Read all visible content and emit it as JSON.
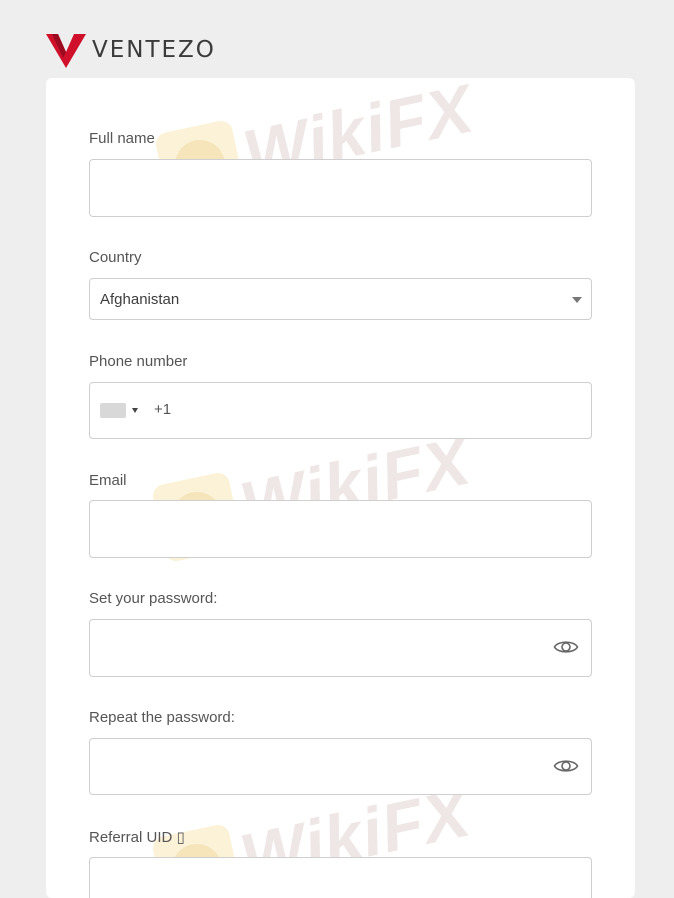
{
  "brand": {
    "name": "VENTEZO"
  },
  "form": {
    "full_name": {
      "label": "Full name",
      "value": ""
    },
    "country": {
      "label": "Country",
      "value": "Afghanistan"
    },
    "phone": {
      "label": "Phone number",
      "dial_code": "+1",
      "value": ""
    },
    "email": {
      "label": "Email",
      "value": ""
    },
    "password": {
      "label": "Set your password:",
      "value": ""
    },
    "repeat_password": {
      "label": "Repeat the password:",
      "value": ""
    },
    "referral": {
      "label": "Referral UID ▯",
      "value": ""
    }
  },
  "watermark": {
    "text": "WikiFX"
  },
  "colors": {
    "brand_red": "#d0102b",
    "background": "#eeeeee",
    "card": "#ffffff",
    "border": "#cfcfcf"
  },
  "icons": {
    "password_toggle": "eye-icon",
    "select_caret": "caret-down-icon"
  }
}
